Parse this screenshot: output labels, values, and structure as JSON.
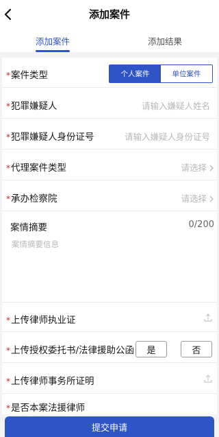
{
  "header": {
    "title": "添加案件"
  },
  "tabs": [
    {
      "label": "添加案件",
      "active": true
    },
    {
      "label": "添加结果",
      "active": false
    }
  ],
  "form": {
    "case_type": {
      "label": "案件类型",
      "options": [
        "个人案件",
        "单位案件"
      ],
      "selected": "个人案件"
    },
    "suspect_name": {
      "label": "犯罪嫌疑人",
      "placeholder": "请输入嫌疑人姓名"
    },
    "suspect_id": {
      "label": "犯罪嫌疑人身份证号",
      "placeholder": "请输入嫌疑人身份证号"
    },
    "agency_case_type": {
      "label": "代理案件类型",
      "placeholder": "请选择"
    },
    "procuratorate": {
      "label": "承办检察院",
      "placeholder": "请选择"
    },
    "summary": {
      "label": "案情摘要",
      "count": "0/200",
      "placeholder": "案情摘要信息"
    },
    "uploads": [
      {
        "label": "上传律师执业证"
      },
      {
        "label": "上传授权委托书/法律援助公函"
      },
      {
        "label": "上传律师事务所证明"
      }
    ],
    "legal_aid": {
      "label": "是否本案法援律师",
      "yes": "是",
      "no": "否"
    }
  },
  "submit": {
    "label": "提交申请"
  },
  "colors": {
    "accent": "#2f54c8",
    "required": "#c8232c"
  }
}
